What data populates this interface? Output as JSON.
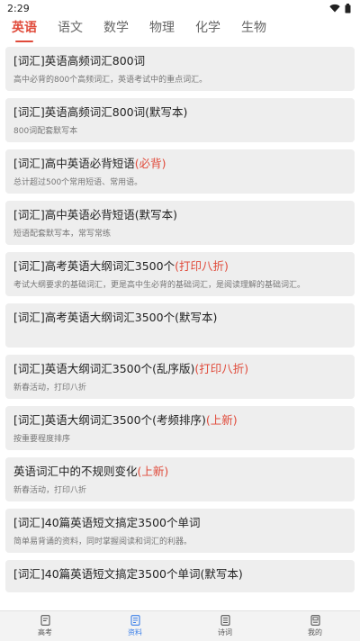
{
  "status": {
    "time": "2:29"
  },
  "tabs": [
    {
      "label": "英语",
      "active": true
    },
    {
      "label": "语文"
    },
    {
      "label": "数学"
    },
    {
      "label": "物理"
    },
    {
      "label": "化学"
    },
    {
      "label": "生物"
    }
  ],
  "items": [
    {
      "title": "[词汇]英语高频词汇800词",
      "tag": "",
      "desc": "高中必背的800个高频词汇，英语考试中的重点词汇。"
    },
    {
      "title": "[词汇]英语高频词汇800词(默写本)",
      "tag": "",
      "desc": "800词配套默写本"
    },
    {
      "title": "[词汇]高中英语必背短语",
      "tag": "(必背)",
      "desc": "总计超过500个常用短语、常用语。"
    },
    {
      "title": "[词汇]高中英语必背短语(默写本)",
      "tag": "",
      "desc": "短语配套默写本，常写常练"
    },
    {
      "title": "[词汇]高考英语大纲词汇3500个",
      "tag": "(打印八折)",
      "desc": "考试大纲要求的基础词汇，更是高中生必背的基础词汇，是阅读理解的基础词汇。"
    },
    {
      "title": "[词汇]高考英语大纲词汇3500个(默写本)",
      "tag": "",
      "desc": ""
    },
    {
      "title": "[词汇]英语大纲词汇3500个(乱序版)",
      "tag": "(打印八折)",
      "desc": "新春活动，打印八折"
    },
    {
      "title": "[词汇]英语大纲词汇3500个(考频排序)",
      "tag": "(上新)",
      "desc": "按重要程度排序"
    },
    {
      "title": "英语词汇中的不规则变化",
      "tag": "(上新)",
      "desc": "新春活动，打印八折"
    },
    {
      "title": "[词汇]40篇英语短文搞定3500个单词",
      "tag": "",
      "desc": "简单易背诵的资料，同时掌握阅读和词汇的利器。"
    },
    {
      "title": "[词汇]40篇英语短文搞定3500个单词(默写本)",
      "tag": "",
      "desc": ""
    }
  ],
  "nav": [
    {
      "label": "高考",
      "icon": "exam-icon"
    },
    {
      "label": "资料",
      "icon": "document-icon",
      "active": true
    },
    {
      "label": "诗词",
      "icon": "poetry-icon"
    },
    {
      "label": "我的",
      "icon": "profile-icon"
    }
  ],
  "colors": {
    "accent": "#e04a3a",
    "nav_active": "#3b7fe8",
    "card_bg": "#eeeeee"
  }
}
